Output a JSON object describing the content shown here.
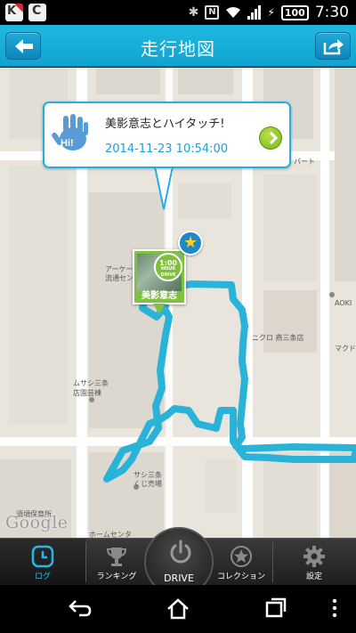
{
  "status_bar": {
    "battery": "100",
    "time": "7:30"
  },
  "header": {
    "title": "走行地図"
  },
  "map": {
    "labels": {
      "arcade": "アーケー",
      "arcade2": "流通セン",
      "park": "パート",
      "aoki": "AOKI",
      "uniqlo": "ニクロ 燕三条店",
      "mac": "マクド",
      "musashi1": "ムサシ三条",
      "musashi2": "店園芸棟",
      "sanjo1": "サシ三条",
      "sanjo2": "くじ売場",
      "school": "須頃保育所",
      "center": "ホームセンタ"
    },
    "attribution": "Google",
    "route_color": "#29b3d9"
  },
  "callout": {
    "title": "美影意志とハイタッチ!",
    "datetime": "2014-11-23 10:54:00"
  },
  "photo_pin": {
    "name": "美影意志",
    "badge_top": "1:00",
    "badge_bottom": "HOUR DRIVE"
  },
  "bottom_nav": {
    "log": "ログ",
    "ranking": "ランキング",
    "drive": "DRIVE",
    "collection": "コレクション",
    "settings": "設定"
  },
  "colors": {
    "accent": "#1fb8e0",
    "active_tab": "#29b6ea"
  }
}
